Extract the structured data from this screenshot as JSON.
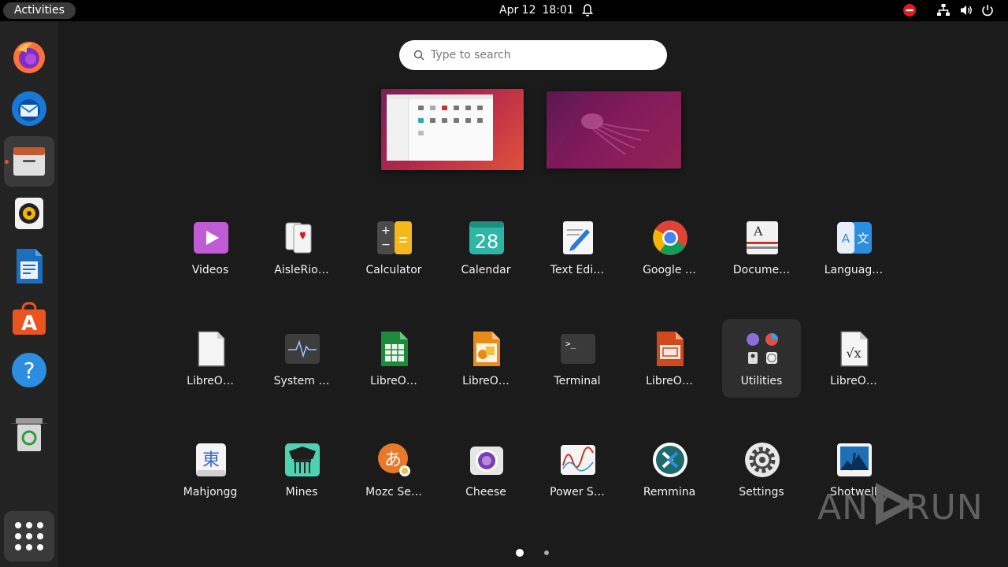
{
  "topbar": {
    "activities": "Activities",
    "date": "Apr 12",
    "time": "18:01",
    "icons": [
      "notifications-bell-icon",
      "stop-record-icon",
      "network-icon",
      "volume-icon",
      "power-icon"
    ],
    "stop_color": "#e01b24"
  },
  "dock": {
    "items": [
      {
        "name": "Firefox",
        "icon": "firefox-icon"
      },
      {
        "name": "Thunderbird",
        "icon": "thunderbird-icon"
      },
      {
        "name": "Files",
        "icon": "files-icon",
        "active": true
      },
      {
        "name": "Rhythmbox",
        "icon": "rhythmbox-icon"
      },
      {
        "name": "LibreOffice Writer",
        "icon": "writer-icon"
      },
      {
        "name": "Ubuntu Software",
        "icon": "ubuntu-software-icon"
      },
      {
        "name": "Help",
        "icon": "help-icon"
      },
      {
        "name": "Trash",
        "icon": "trash-icon"
      }
    ],
    "show_apps_icon": "show-apps-grid-icon",
    "running_indicator_color": "#e95420"
  },
  "search": {
    "placeholder": "Type to search"
  },
  "workspaces": [
    "workspace-1",
    "workspace-2"
  ],
  "apps": [
    {
      "label": "Videos",
      "icon": "videos-icon"
    },
    {
      "label": "AisleRio…",
      "icon": "aisleriot-icon"
    },
    {
      "label": "Calculator",
      "icon": "calculator-icon"
    },
    {
      "label": "Calendar",
      "icon": "calendar-icon",
      "day": "28"
    },
    {
      "label": "Text Edi…",
      "icon": "text-editor-icon"
    },
    {
      "label": "Google …",
      "icon": "chrome-icon"
    },
    {
      "label": "Docume…",
      "icon": "document-viewer-icon",
      "glyph": "A"
    },
    {
      "label": "Languag…",
      "icon": "language-icon",
      "glyph": "A",
      "glyph2": "文"
    },
    {
      "label": "LibreO…",
      "icon": "libreoffice-icon"
    },
    {
      "label": "System …",
      "icon": "system-monitor-icon"
    },
    {
      "label": "LibreO…",
      "icon": "libreoffice-calc-icon"
    },
    {
      "label": "LibreO…",
      "icon": "libreoffice-draw-icon"
    },
    {
      "label": "Terminal",
      "icon": "terminal-icon",
      "prompt": ">_"
    },
    {
      "label": "LibreO…",
      "icon": "libreoffice-impress-icon"
    },
    {
      "label": "Utilities",
      "icon": "utilities-folder-icon",
      "highlighted": true
    },
    {
      "label": "LibreO…",
      "icon": "libreoffice-math-icon"
    },
    {
      "label": "Mahjongg",
      "icon": "mahjongg-icon",
      "glyph": "東"
    },
    {
      "label": "Mines",
      "icon": "mines-icon"
    },
    {
      "label": "Mozc Se…",
      "icon": "mozc-icon",
      "glyph": "あ"
    },
    {
      "label": "Cheese",
      "icon": "cheese-icon"
    },
    {
      "label": "Power S…",
      "icon": "power-statistics-icon"
    },
    {
      "label": "Remmina",
      "icon": "remmina-icon"
    },
    {
      "label": "Settings",
      "icon": "settings-gear-icon"
    },
    {
      "label": "Shotwell",
      "icon": "shotwell-icon"
    }
  ],
  "pages": {
    "current": 1,
    "total": 2
  },
  "watermark": {
    "text_left": "ANY",
    "text_right": "RUN"
  }
}
